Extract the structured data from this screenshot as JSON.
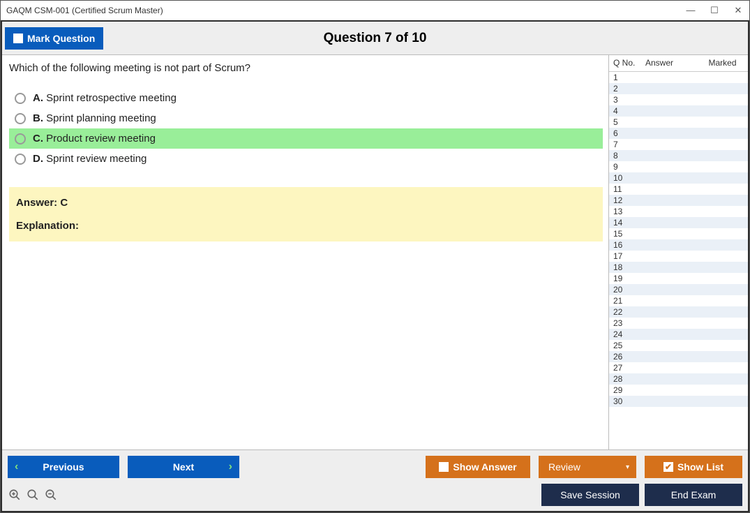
{
  "window_title": "GAQM CSM-001 (Certified Scrum Master)",
  "toolbar": {
    "mark_question": "Mark Question",
    "question_title": "Question 7 of 10"
  },
  "question": {
    "prompt": "Which of the following meeting is not part of Scrum?",
    "options": [
      {
        "letter": "A.",
        "text": "Sprint retrospective meeting",
        "selected": false
      },
      {
        "letter": "B.",
        "text": "Sprint planning meeting",
        "selected": false
      },
      {
        "letter": "C.",
        "text": "Product review meeting",
        "selected": true
      },
      {
        "letter": "D.",
        "text": "Sprint review meeting",
        "selected": false
      }
    ],
    "answer_label": "Answer: C",
    "explanation_label": "Explanation:"
  },
  "side_panel": {
    "columns": {
      "qno": "Q No.",
      "answer": "Answer",
      "marked": "Marked"
    },
    "rows": [
      1,
      2,
      3,
      4,
      5,
      6,
      7,
      8,
      9,
      10,
      11,
      12,
      13,
      14,
      15,
      16,
      17,
      18,
      19,
      20,
      21,
      22,
      23,
      24,
      25,
      26,
      27,
      28,
      29,
      30
    ]
  },
  "bottom": {
    "previous": "Previous",
    "next": "Next",
    "show_answer": "Show Answer",
    "review": "Review",
    "show_list": "Show List",
    "save_session": "Save Session",
    "end_exam": "End Exam"
  }
}
